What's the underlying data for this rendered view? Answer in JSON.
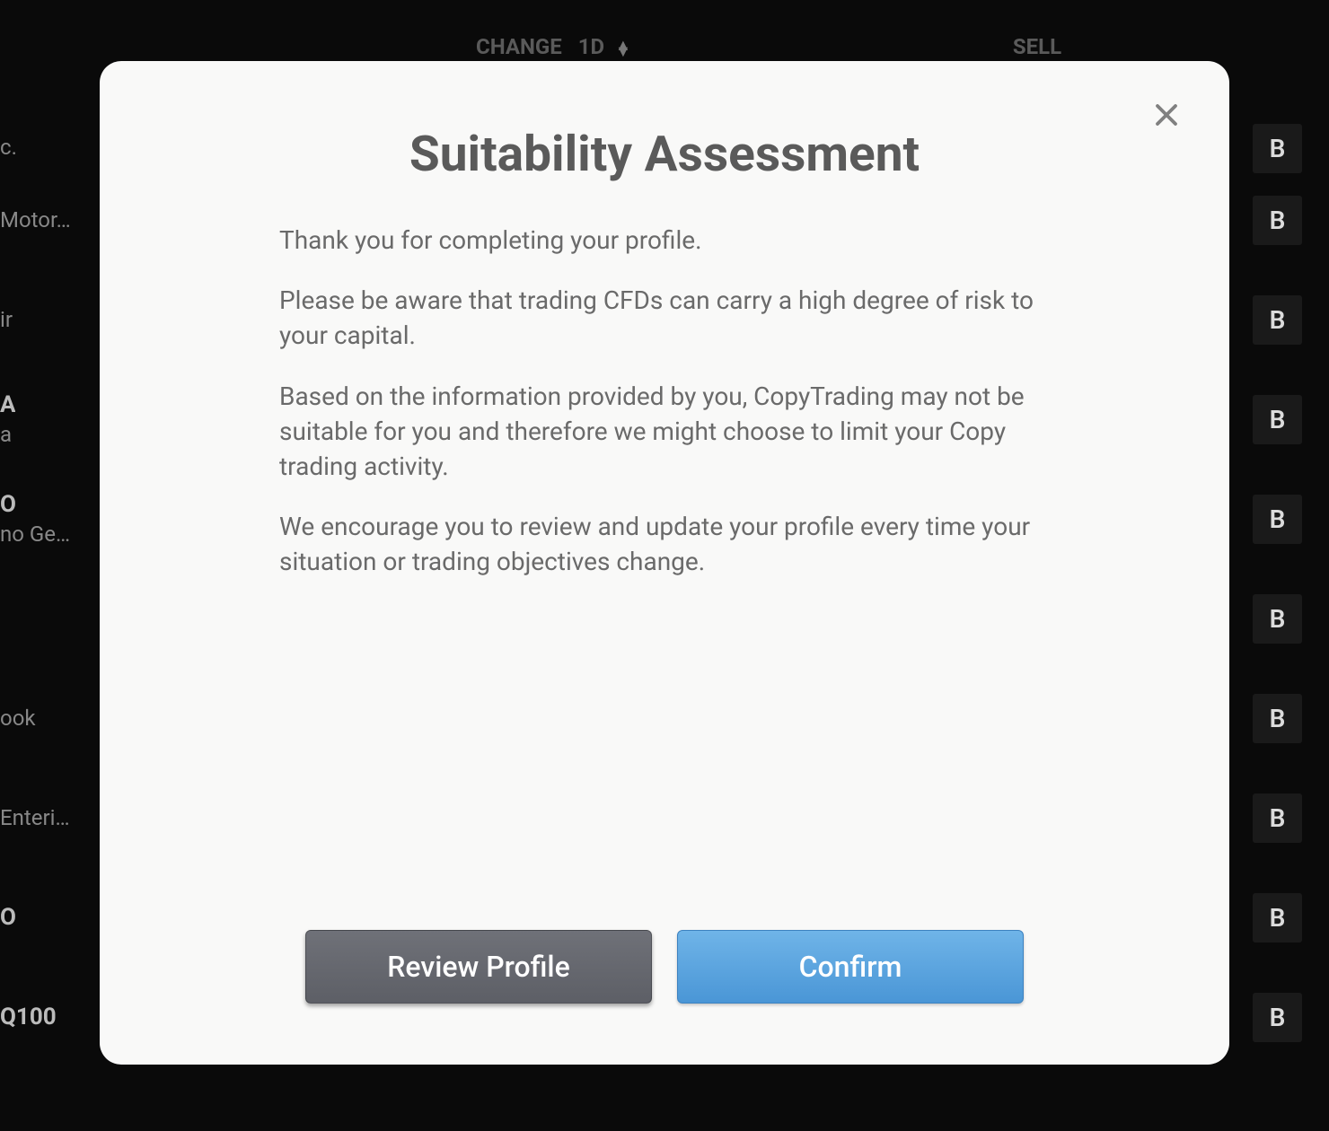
{
  "background": {
    "columns": {
      "change": "CHANGE",
      "change_period": "1D",
      "sell": "SELL"
    },
    "buy_label": "B",
    "rows": [
      {
        "symbol": "",
        "name": "c."
      },
      {
        "symbol": "",
        "name": "Motor…"
      },
      {
        "symbol": "",
        "name": "ir"
      },
      {
        "symbol": "A",
        "name": "a"
      },
      {
        "symbol": "O",
        "name": "no Ge…"
      },
      {
        "symbol": "",
        "name": ""
      },
      {
        "symbol": "",
        "name": "ook"
      },
      {
        "symbol": "",
        "name": "Enteri…"
      },
      {
        "symbol": "O",
        "name": ""
      },
      {
        "symbol": "Q100",
        "name": ""
      }
    ]
  },
  "modal": {
    "title": "Suitability Assessment",
    "paragraphs": [
      "Thank you for completing your profile.",
      "Please be aware that trading CFDs can carry a high degree of risk to your capital.",
      "Based on the information provided by you, CopyTrading may not be suitable for you and therefore we might choose to limit your Copy trading activity.",
      "We encourage you to review and update your profile every time your situation or trading objectives change."
    ],
    "buttons": {
      "review": "Review Profile",
      "confirm": "Confirm"
    }
  }
}
